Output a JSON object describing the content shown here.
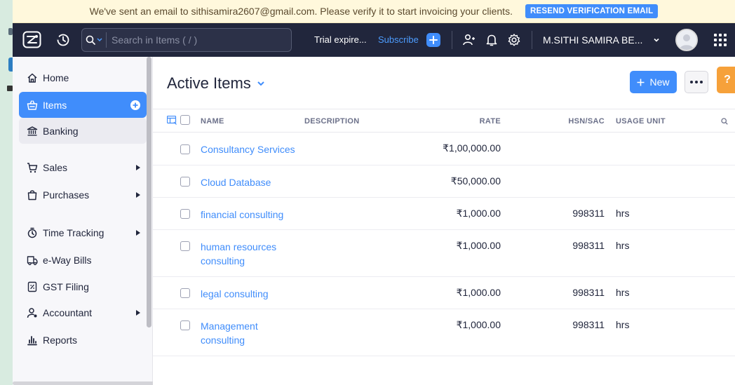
{
  "banner": {
    "message": "We've sent an email to sithisamira2607@gmail.com. Please verify it to start invoicing your clients.",
    "button": "RESEND VERIFICATION EMAIL"
  },
  "topbar": {
    "search_placeholder": "Search in Items ( / )",
    "trial": "Trial expire...",
    "subscribe": "Subscribe",
    "org_name": "M.SITHI SAMIRA BE..."
  },
  "sidebar": {
    "items": [
      {
        "label": "Home",
        "icon": "home-icon"
      },
      {
        "label": "Items",
        "icon": "basket-icon",
        "active": true
      },
      {
        "label": "Banking",
        "icon": "bank-icon"
      },
      {
        "label": "Sales",
        "icon": "cart-icon",
        "has_arrow": true
      },
      {
        "label": "Purchases",
        "icon": "bag-icon",
        "has_arrow": true
      },
      {
        "label": "Time Tracking",
        "icon": "stopwatch-icon",
        "has_arrow": true
      },
      {
        "label": "e-Way Bills",
        "icon": "truck-icon"
      },
      {
        "label": "GST Filing",
        "icon": "document-icon"
      },
      {
        "label": "Accountant",
        "icon": "accountant-icon",
        "has_arrow": true
      },
      {
        "label": "Reports",
        "icon": "chart-icon"
      }
    ]
  },
  "main": {
    "title": "Active Items",
    "new_button": "New",
    "help": "?"
  },
  "table": {
    "columns": {
      "name": "NAME",
      "description": "DESCRIPTION",
      "rate": "RATE",
      "hsn": "HSN/SAC",
      "unit": "USAGE UNIT"
    },
    "rows": [
      {
        "name": "Consultancy Services",
        "description": "",
        "rate": "₹1,00,000.00",
        "hsn": "",
        "unit": ""
      },
      {
        "name": "Cloud Database",
        "description": "",
        "rate": "₹50,000.00",
        "hsn": "",
        "unit": ""
      },
      {
        "name": "financial consulting",
        "description": "",
        "rate": "₹1,000.00",
        "hsn": "998311",
        "unit": "hrs"
      },
      {
        "name": "human resources consulting",
        "description": "",
        "rate": "₹1,000.00",
        "hsn": "998311",
        "unit": "hrs"
      },
      {
        "name": "legal consulting",
        "description": "",
        "rate": "₹1,000.00",
        "hsn": "998311",
        "unit": "hrs"
      },
      {
        "name": "Management consulting",
        "description": "",
        "rate": "₹1,000.00",
        "hsn": "998311",
        "unit": "hrs"
      }
    ]
  },
  "colors": {
    "accent": "#408dfb",
    "topbar": "#21263c",
    "banner_bg": "#fff8dc",
    "help": "#f6a13a"
  }
}
